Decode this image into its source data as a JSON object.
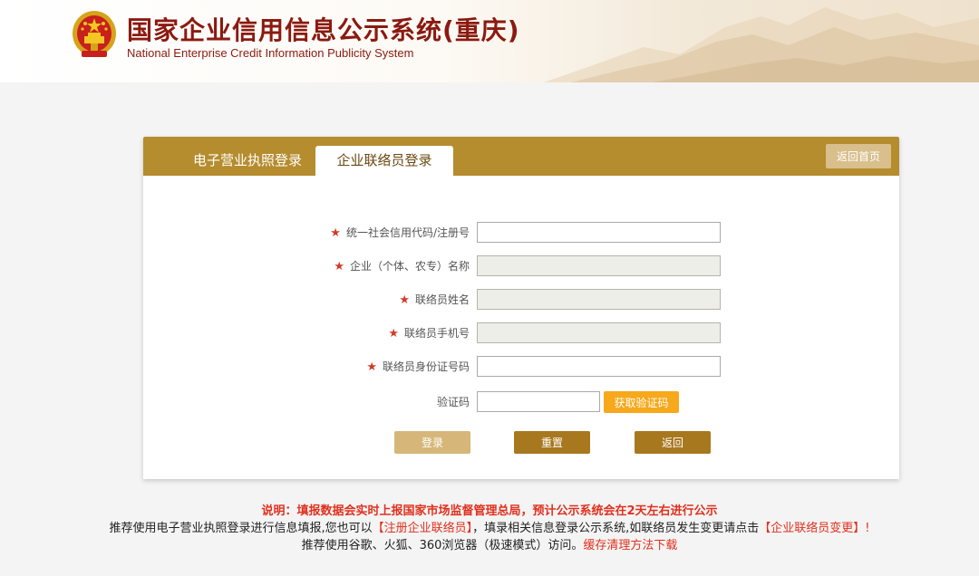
{
  "header": {
    "title": "国家企业信用信息公示系统(重庆)",
    "subtitle": "National Enterprise Credit Information Publicity System",
    "emblem_icon": "national-emblem-icon"
  },
  "tabs": {
    "license_login": "电子营业执照登录",
    "liaison_login": "企业联络员登录"
  },
  "home_button": "返回首页",
  "form": {
    "required_mark": "★",
    "fields": [
      {
        "label": "统一社会信用代码/注册号",
        "required": true,
        "value": "",
        "disabled": false
      },
      {
        "label": "企业（个体、农专）名称",
        "required": true,
        "value": "",
        "disabled": true
      },
      {
        "label": "联络员姓名",
        "required": true,
        "value": "",
        "disabled": true
      },
      {
        "label": "联络员手机号",
        "required": true,
        "value": "",
        "disabled": true
      },
      {
        "label": "联络员身份证号码",
        "required": true,
        "value": "",
        "disabled": false
      }
    ],
    "captcha_label": "验证码",
    "captcha_value": "",
    "captcha_button": "获取验证码"
  },
  "actions": {
    "login": "登录",
    "reset": "重置",
    "back": "返回"
  },
  "notice": {
    "title": "说明：填报数据会实时上报国家市场监督管理总局，预计公示系统会在2天左右进行公示",
    "line1_a": "推荐使用电子营业执照登录进行信息填报,您也可以",
    "line1_link1": "【注册企业联络员】",
    "line1_b": "，填录相关信息登录公示系统,如联络员发生变更请点击",
    "line1_link2": "【企业联络员变更】!",
    "line2_a": "推荐使用谷歌、火狐、360浏览器（极速模式）访问。",
    "line2_link": "缓存清理方法下载"
  },
  "colors": {
    "brand_red": "#8b1a10",
    "panel_gold": "#b58c2e",
    "accent_orange": "#f7a81b",
    "notice_red": "#e0301e"
  }
}
